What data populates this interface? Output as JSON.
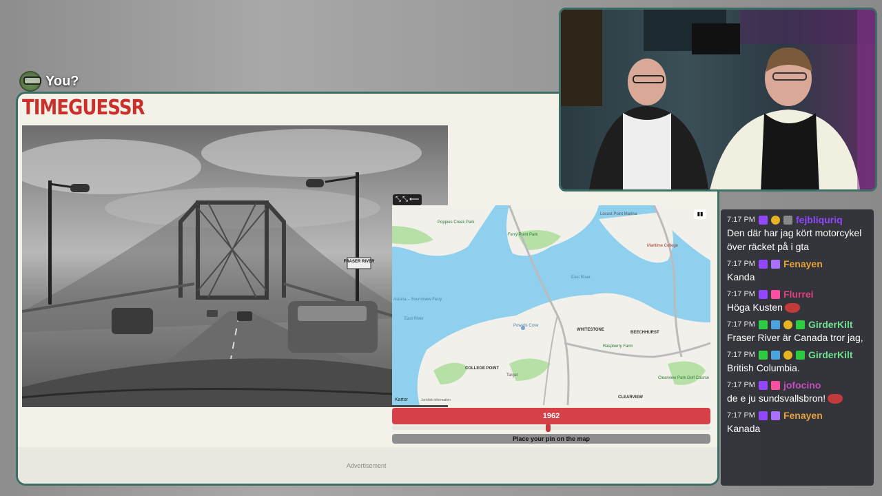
{
  "overlay": {
    "player_label": "You?"
  },
  "game": {
    "logo": "TIMEGUESSR",
    "year": "1962",
    "pin_prompt": "Place your pin on the map",
    "advertisement": "Advertisement",
    "map": {
      "tools": [
        "⤡",
        "⤡",
        "⟵"
      ],
      "credit": " Kartor",
      "legal": "Juridisk information",
      "labels": {
        "poppies_creek_park": "Poppies Creek Park",
        "ferry_point_park": "Ferry Point Park",
        "locust_point_marina": "Locust Point Marina",
        "maritime_college": "Maritime College",
        "east_river": "East River",
        "ferry": "Astoria – Soundview Ferry",
        "east_river_2": "East River",
        "whitestone": "WHITESTONE",
        "beechhurst": "BEECHHURST",
        "raspberry_farm": "Raspberry Farm",
        "college_point": "COLLEGE POINT",
        "target": "Target",
        "clearview_park": "Clearview Park Golf Course",
        "clearview": "CLEARVIEW",
        "powells_cove": "Powells Cove"
      }
    },
    "photo_sign": "FRASER RIVER"
  },
  "chat": {
    "messages": [
      {
        "time": "7:17 PM",
        "badges": [
          "twitch",
          "gold",
          "gray"
        ],
        "name": "fejbliquriq",
        "name_color": "#9147ff",
        "text": "Den där har jag kört motorcykel över räcket på i gta",
        "emote": false
      },
      {
        "time": "7:17 PM",
        "badges": [
          "twitch",
          "sub"
        ],
        "name": "Fenayen",
        "name_color": "#e6a23c",
        "text": "Kanda",
        "emote": false
      },
      {
        "time": "7:17 PM",
        "badges": [
          "twitch",
          "pink"
        ],
        "name": "Flurrei",
        "name_color": "#e0417f",
        "text": "Höga Kusten",
        "emote": true
      },
      {
        "time": "7:17 PM",
        "badges": [
          "green",
          "blue",
          "gold",
          "green"
        ],
        "name": "GirderKilt",
        "name_color": "#6fe08f",
        "text": "Fraser River är Canada tror jag,",
        "emote": false
      },
      {
        "time": "7:17 PM",
        "badges": [
          "green",
          "blue",
          "gold",
          "green"
        ],
        "name": "GirderKilt",
        "name_color": "#6fe08f",
        "text": "British Columbia.",
        "emote": false
      },
      {
        "time": "7:17 PM",
        "badges": [
          "twitch",
          "pink"
        ],
        "name": "jofocino",
        "name_color": "#c24fbf",
        "text": "de e ju sundsvallsbron!",
        "emote": true
      },
      {
        "time": "7:17 PM",
        "badges": [
          "twitch",
          "sub"
        ],
        "name": "Fenayen",
        "name_color": "#e6a23c",
        "text": "Kanada",
        "emote": false
      }
    ]
  }
}
